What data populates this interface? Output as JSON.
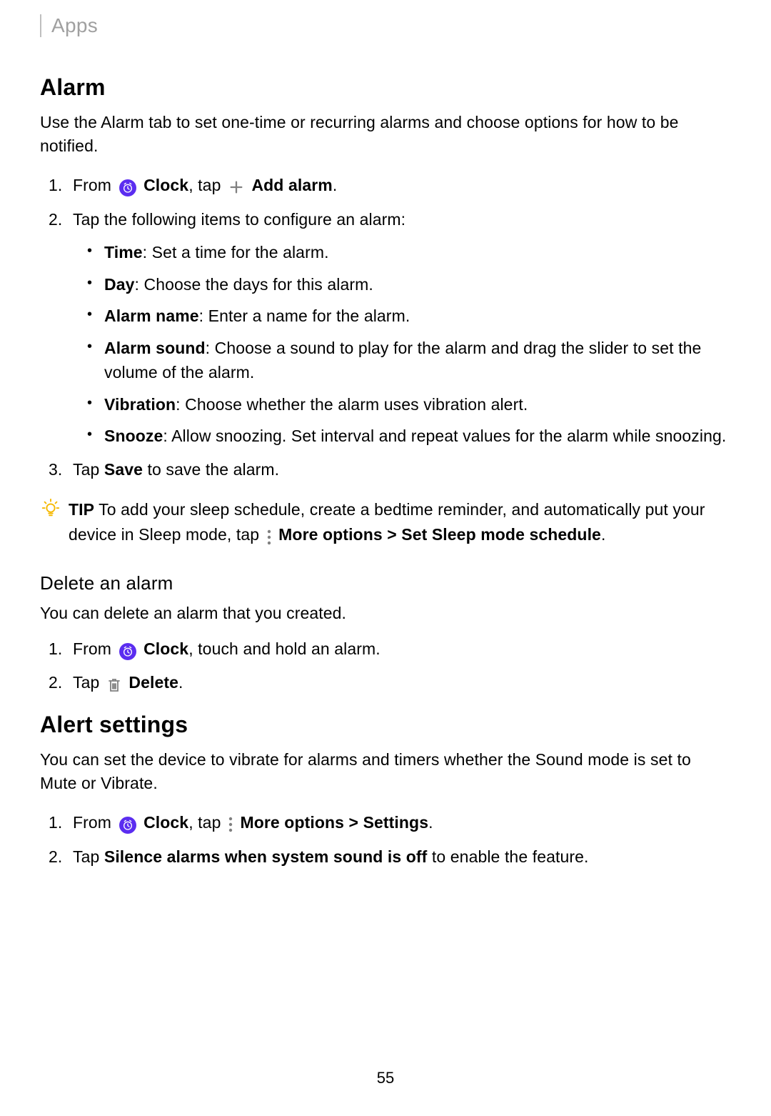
{
  "breadcrumb": "Apps",
  "alarm": {
    "heading": "Alarm",
    "intro": "Use the Alarm tab to set one-time or recurring alarms and choose options for how to be notified.",
    "step1_from": "From ",
    "clock_label": "Clock",
    "step1_mid": ", tap ",
    "add_alarm_label": "Add alarm",
    "step1_end": ".",
    "step2": "Tap the following items to configure an alarm:",
    "sub": [
      {
        "label": "Time",
        "desc": ": Set a time for the alarm."
      },
      {
        "label": "Day",
        "desc": ": Choose the days for this alarm."
      },
      {
        "label": "Alarm name",
        "desc": ": Enter a name for the alarm."
      },
      {
        "label": "Alarm sound",
        "desc": ": Choose a sound to play for the alarm and drag the slider to set the volume of the alarm."
      },
      {
        "label": "Vibration",
        "desc": ": Choose whether the alarm uses vibration alert."
      },
      {
        "label": "Snooze",
        "desc": ": Allow snoozing. Set interval and repeat values for the alarm while snoozing."
      }
    ],
    "step3_pre": "Tap ",
    "step3_bold": "Save",
    "step3_post": " to save the alarm.",
    "tip_label": "TIP",
    "tip_pre": "  To add your sleep schedule, create a bedtime reminder, and automatically put your device in Sleep mode, tap ",
    "tip_bold1": "More options",
    "tip_mid": " > ",
    "tip_bold2": "Set Sleep mode schedule",
    "tip_end": "."
  },
  "delete": {
    "heading": "Delete an alarm",
    "intro": "You can delete an alarm that you created.",
    "step1_from": "From ",
    "clock_label": "Clock",
    "step1_end": ", touch and hold an alarm.",
    "step2_pre": "Tap ",
    "delete_label": "Delete",
    "step2_end": "."
  },
  "alert": {
    "heading": "Alert settings",
    "intro": "You can set the device to vibrate for alarms and timers whether the Sound mode is set to Mute or Vibrate.",
    "step1_from": "From ",
    "clock_label": "Clock",
    "step1_mid": ", tap ",
    "more_label": "More options",
    "step1_gt": " > ",
    "settings_label": "Settings",
    "step1_end": ".",
    "step2_pre": "Tap ",
    "step2_bold": "Silence alarms when system sound is off",
    "step2_post": " to enable the feature."
  },
  "page_number": "55"
}
